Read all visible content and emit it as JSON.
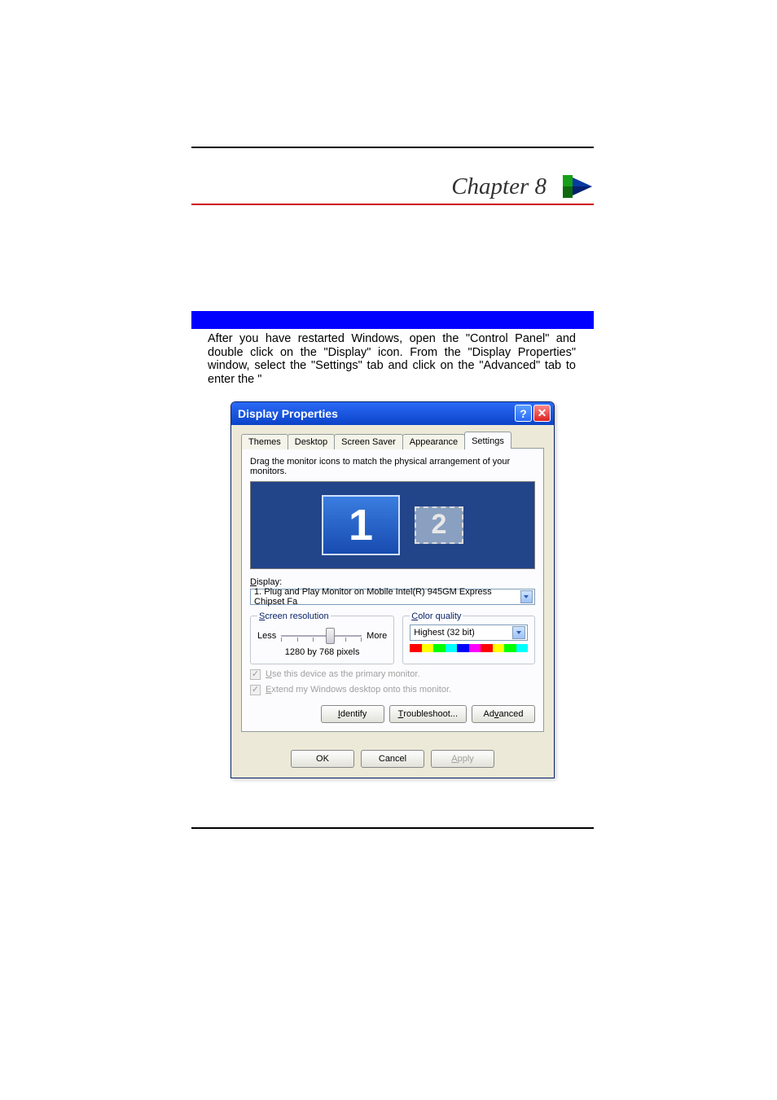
{
  "chapter": {
    "title": "Chapter 8"
  },
  "intro": "After you have restarted Windows, open the \"Control Panel\" and double click on the \"Display\" icon. From the \"Display Properties\" window, select the \"Settings\" tab and click on the \"Advanced\" tab to enter the \"",
  "dialog": {
    "title": "Display Properties",
    "help": "?",
    "close": "✕",
    "tabs": {
      "themes": "Themes",
      "desktop": "Desktop",
      "screensaver": "Screen Saver",
      "appearance": "Appearance",
      "settings": "Settings"
    },
    "instruction": "Drag the monitor icons to match the physical arrangement of your monitors.",
    "monitors": {
      "m1": "1",
      "m2": "2"
    },
    "display_label_u": "D",
    "display_label_rest": "isplay:",
    "display_value": "1. Plug and Play Monitor on Mobile Intel(R) 945GM Express Chipset Fa",
    "screen_res": {
      "legend_u": "S",
      "legend_rest": "creen resolution",
      "less": "Less",
      "more": "More",
      "value": "1280 by 768 pixels"
    },
    "color_quality": {
      "legend_u": "C",
      "legend_rest": "olor quality",
      "value": "Highest (32 bit)"
    },
    "check1_u": "U",
    "check1_rest": "se this device as the primary monitor.",
    "check2_u": "E",
    "check2_rest": "xtend my Windows desktop onto this monitor.",
    "identify_u": "I",
    "identify_rest": "dentify",
    "troubleshoot_u": "T",
    "troubleshoot_rest": "roubleshoot...",
    "advanced": "Ad",
    "advanced_u": "v",
    "advanced_rest": "anced",
    "ok": "OK",
    "cancel": "Cancel",
    "apply_u": "A",
    "apply_rest": "pply"
  }
}
